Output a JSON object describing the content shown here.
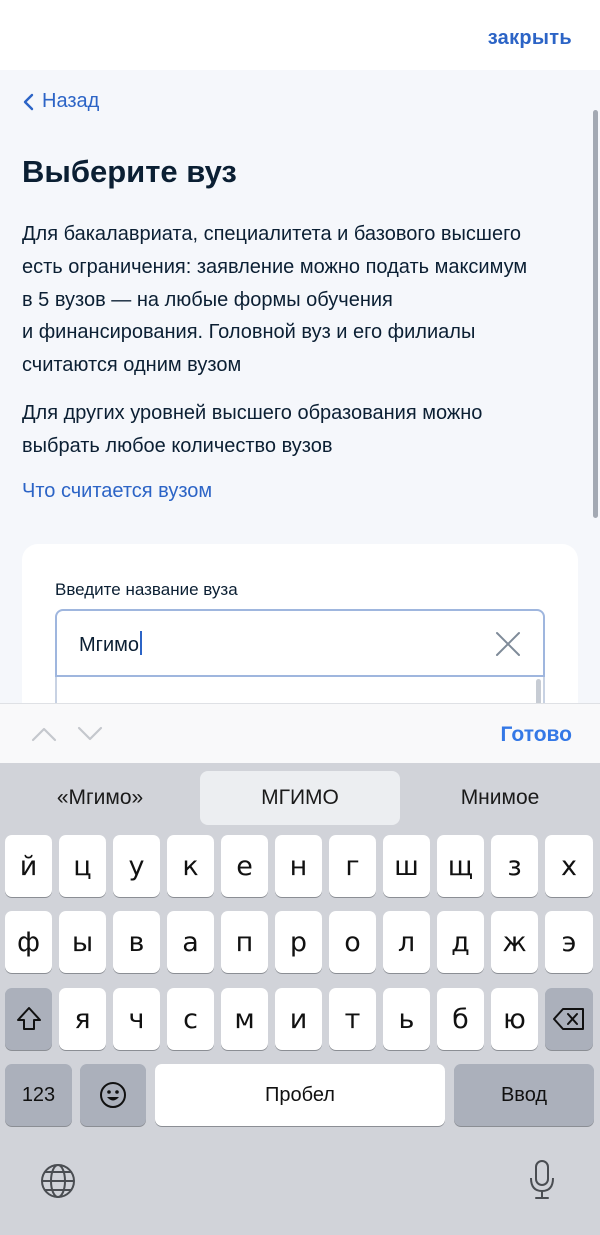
{
  "header": {
    "close_label": "закрыть"
  },
  "nav": {
    "back_label": "Назад"
  },
  "page": {
    "title": "Выберите вуз",
    "paragraph1": "Для бакалавриата, специалитета и базового высшего\nесть ограничения: заявление можно подать максимум\nв 5 вузов — на любые формы обучения\nи финансирования. Головной вуз и его филиалы\nсчитаются одним вузом",
    "paragraph2": "Для других уровней высшего образования можно\nвыбрать любое количество вузов",
    "info_link": "Что считается вузом"
  },
  "form": {
    "field_label": "Введите название вуза",
    "field_value": "Мгимо"
  },
  "accessory": {
    "done_label": "Готово"
  },
  "keyboard": {
    "suggestions": [
      "«Мгимо»",
      "МГИМО",
      "Мнимое"
    ],
    "row1": [
      "й",
      "ц",
      "у",
      "к",
      "е",
      "н",
      "г",
      "ш",
      "щ",
      "з",
      "х"
    ],
    "row2": [
      "ф",
      "ы",
      "в",
      "а",
      "п",
      "р",
      "о",
      "л",
      "д",
      "ж",
      "э"
    ],
    "row3": [
      "я",
      "ч",
      "с",
      "м",
      "и",
      "т",
      "ь",
      "б",
      "ю"
    ],
    "numbers_label": "123",
    "space_label": "Пробел",
    "return_label": "Ввод"
  }
}
